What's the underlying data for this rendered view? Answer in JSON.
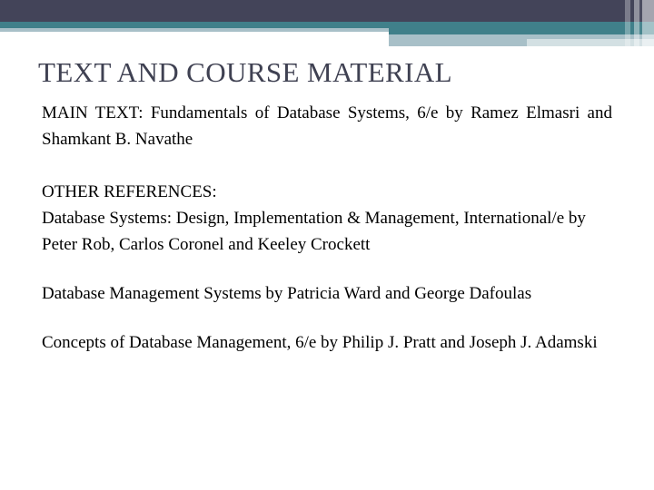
{
  "slide": {
    "title": "TEXT AND COURSE MATERIAL",
    "paragraphs": [
      "MAIN TEXT: Fundamentals of Database Systems, 6/e by Ramez Elmasri and Shamkant B. Navathe",
      "OTHER REFERENCES:",
      "Database Systems: Design, Implementation & Management, International/e by Peter Rob, Carlos Coronel and Keeley Crockett",
      "Database Management Systems by Patricia Ward and George Dafoulas",
      "Concepts of Database Management, 6/e by Philip J. Pratt and Joseph J. Adamski"
    ]
  },
  "theme": {
    "dark_band": "#434459",
    "teal_band": "#40808a",
    "light_band": "#a8c0c8",
    "pale_band": "#d3e0e3",
    "title_color": "#3f4152",
    "body_color": "#000000",
    "background": "#ffffff"
  }
}
